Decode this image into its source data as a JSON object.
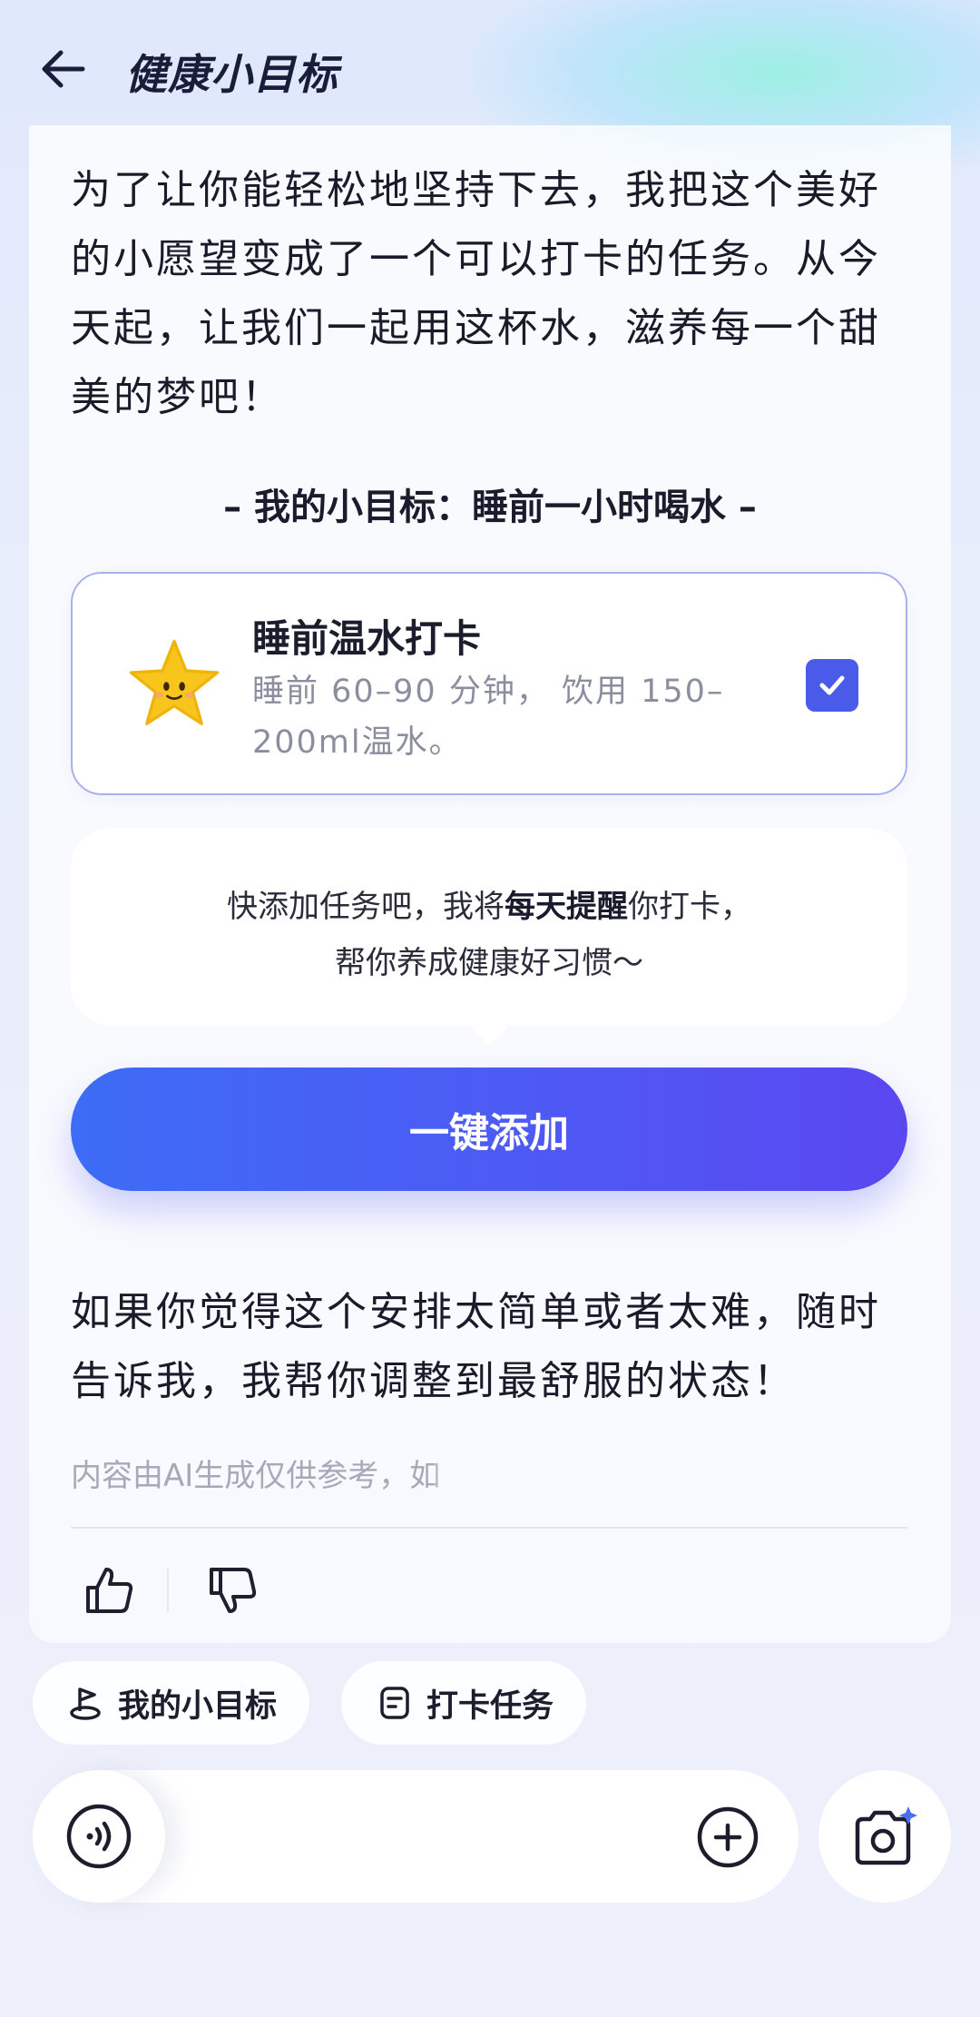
{
  "header": {
    "title": "健康小目标",
    "back_icon": "arrow-left-icon"
  },
  "message": {
    "intro": "为了让你能轻松地坚持下去，我把这个美好的小愿望变成了一个可以打卡的任务。从今天起，让我们一起用这杯水，滋养每一个甜美的梦吧！",
    "goal_heading": "– 我的小目标：睡前一小时喝水 –",
    "task": {
      "title": "睡前温水打卡",
      "description": "睡前 60–90 分钟， 饮用 150–200ml温水。",
      "icon": "star-mascot-icon",
      "checked": true
    },
    "bubble": {
      "text_before": "快添加任务吧，我将",
      "text_bold": "每天提醒",
      "text_after": "你打卡，",
      "line2": "帮你养成健康好习惯～"
    },
    "add_button": "一键添加",
    "outro": "如果你觉得这个安排太简单或者太难，随时告诉我，我帮你调整到最舒服的状态！",
    "disclaimer": "内容由AI生成仅供参考，如"
  },
  "chips": [
    {
      "label": "我的小目标",
      "icon": "goal-flag-icon"
    },
    {
      "label": "打卡任务",
      "icon": "checkin-task-icon"
    }
  ],
  "colors": {
    "accent": "#4a5bea",
    "button_start": "#3d6cf6",
    "button_end": "#5a47f0"
  }
}
